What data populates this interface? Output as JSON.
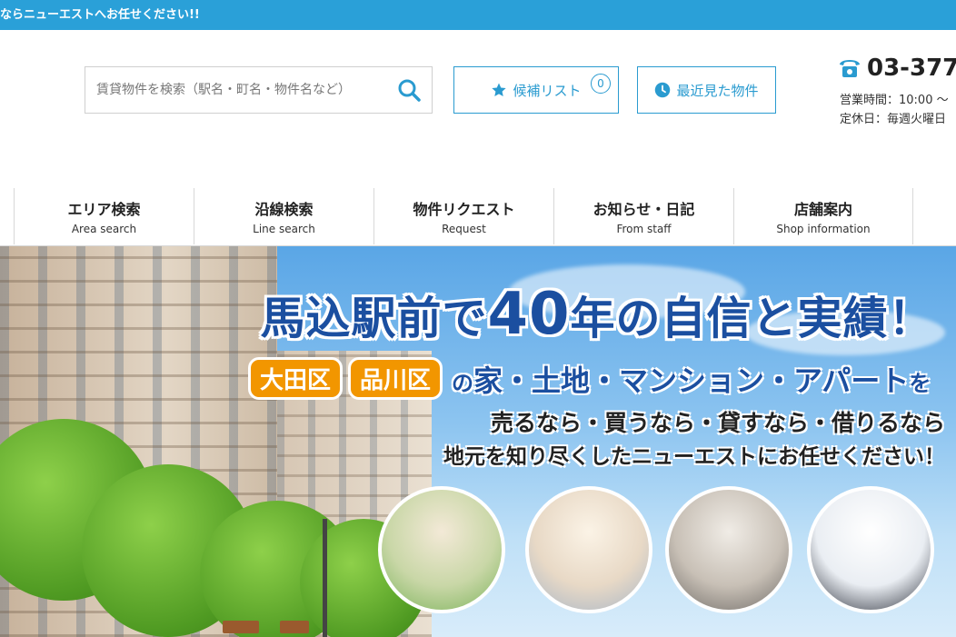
{
  "topbar": {
    "text": "ならニューエストへお任せください!!"
  },
  "search": {
    "placeholder": "賃貸物件を検索（駅名・町名・物件名など）"
  },
  "favorites": {
    "label": "候補リスト",
    "count": "0"
  },
  "recent": {
    "label": "最近見た物件"
  },
  "contact": {
    "phone": "03-377",
    "hours": "営業時間：10:00 〜",
    "closed": "定休日：毎週火曜日"
  },
  "nav": [
    {
      "jp": "エリア検索",
      "en": "Area search"
    },
    {
      "jp": "沿線検索",
      "en": "Line search"
    },
    {
      "jp": "物件リクエスト",
      "en": "Request"
    },
    {
      "jp": "お知らせ・日記",
      "en": "From staff"
    },
    {
      "jp": "店舗案内",
      "en": "Shop information"
    }
  ],
  "hero": {
    "headline_a": "馬込駅前で",
    "headline_num": "40",
    "headline_b": "年の自信と実績！",
    "area1": "大田区",
    "area2": "品川区",
    "props_no": "の",
    "props": "家・土地・マンション・アパート",
    "props_wo": "を",
    "line3": "売るなら・買うなら・貸すなら・借りるなら",
    "line4": "地元を知り尽くしたニューエストにお任せください！"
  },
  "colors": {
    "brand_blue": "#2aa0d8",
    "headline_blue": "#1b4fa0",
    "orange": "#f29600"
  }
}
